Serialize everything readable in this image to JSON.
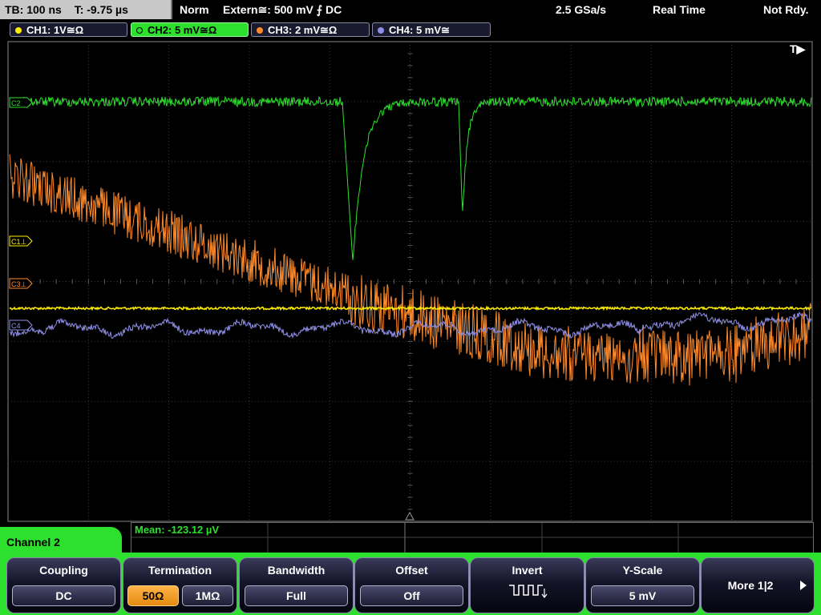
{
  "topbar": {
    "timebase": "TB: 100 ns",
    "trigger_time": "T: -9.75 µs",
    "mode": "Norm",
    "trigger_source": "Extern≅: 500 mV ⨍ DC",
    "sample_rate": "2.5 GSa/s",
    "acq_mode": "Real Time",
    "status": "Not Rdy."
  },
  "channels": [
    {
      "label": "CH1: 1V≅Ω",
      "color": "#ffee00",
      "active": false
    },
    {
      "label": "CH2: 5 mV≅Ω",
      "color": "#2ee02e",
      "active": true
    },
    {
      "label": "CH3: 2 mV≅Ω",
      "color": "#ff8a2a",
      "active": false
    },
    {
      "label": "CH4: 5 mV≅",
      "color": "#8f8fe8",
      "active": false
    }
  ],
  "markers": {
    "c1": "C1⊥",
    "c3": "C3⊥",
    "c2": "C2",
    "c4": "C4",
    "trigger_flag": "T▶"
  },
  "measurement": {
    "mean": "Mean: -123.12 µV"
  },
  "menu": {
    "title": "Channel 2",
    "softkeys": [
      {
        "label": "Coupling",
        "value": "DC"
      },
      {
        "label": "Termination",
        "options": [
          "50Ω",
          "1MΩ"
        ],
        "selected": "50Ω"
      },
      {
        "label": "Bandwidth",
        "value": "Full"
      },
      {
        "label": "Offset",
        "value": "Off"
      },
      {
        "label": "Invert",
        "icon": "inverted-square-wave-icon"
      },
      {
        "label": "Y-Scale",
        "value": "5 mV"
      },
      {
        "label": "More 1|2",
        "icon": "right-arrow-icon"
      }
    ]
  },
  "colors": {
    "ch1": "#ffee00",
    "ch2": "#2ee02e",
    "ch3": "#ff8a2a",
    "ch4": "#8f8fe8",
    "menu_accent": "#2ee02e"
  }
}
